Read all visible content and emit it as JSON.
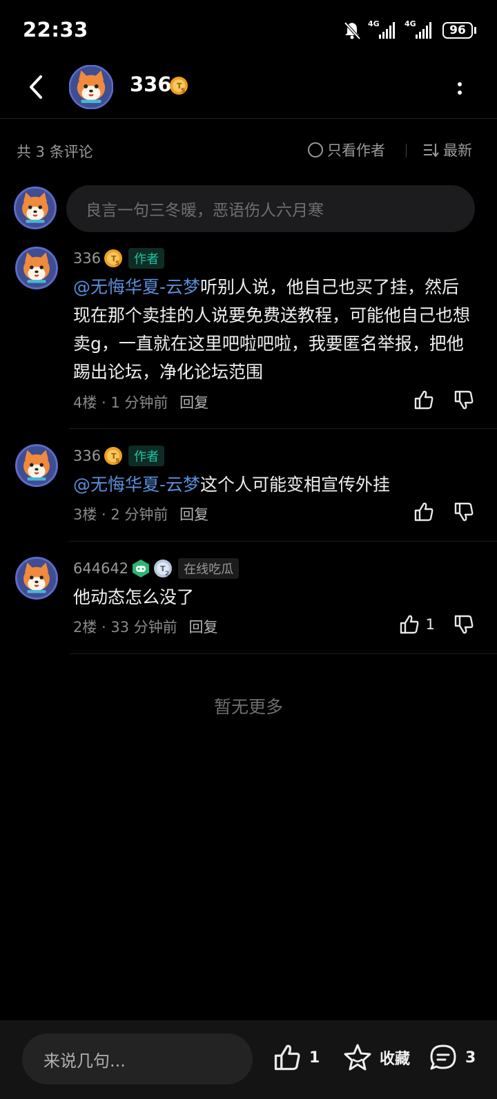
{
  "status_bar": {
    "time": "22:33",
    "net1": "4G",
    "net2": "4G",
    "battery": "96"
  },
  "header": {
    "title": "336",
    "level_badge": "5"
  },
  "summary": {
    "count_text": "共 3 条评论",
    "only_author": "只看作者",
    "sort": "最新"
  },
  "input": {
    "placeholder": "良言一句三冬暖，恶语伤人六月寒"
  },
  "comments": [
    {
      "user": "336",
      "level": "5",
      "tag": "作者",
      "mention": "@无悔华夏-云梦",
      "text": "听别人说，他自己也买了挂，然后现在那个卖挂的人说要免费送教程，可能他自己也想卖g，一直就在这里吧啦吧啦，我要匿名举报，把他踢出论坛，净化论坛范围",
      "floor_time": "4楼 · 1 分钟前",
      "reply": "回复",
      "likes": ""
    },
    {
      "user": "336",
      "level": "5",
      "tag": "作者",
      "mention": "@无悔华夏-云梦",
      "text": "这个人可能变相宣传外挂",
      "floor_time": "3楼 · 2 分钟前",
      "reply": "回复",
      "likes": ""
    },
    {
      "user": "644642",
      "level": "2",
      "tag": "在线吃瓜",
      "mention": "",
      "text": "他动态怎么没了",
      "floor_time": "2楼 · 33 分钟前",
      "reply": "回复",
      "likes": "1"
    }
  ],
  "no_more": "暂无更多",
  "bottom_bar": {
    "say_placeholder": "来说几句...",
    "like_count": "1",
    "favorite_label": "收藏",
    "comment_count": "3"
  },
  "colors": {
    "accent_green": "#1fc5a0",
    "mention_blue": "#5a8ed8",
    "badge_gold": "#f0a020"
  },
  "icons": [
    "bell-off-icon",
    "signal-icon",
    "battery-icon",
    "back-icon",
    "more-icon",
    "circle-icon",
    "sort-icon",
    "thumbs-up-icon",
    "thumbs-down-icon",
    "star-icon",
    "comment-icon",
    "gamepad-icon"
  ]
}
